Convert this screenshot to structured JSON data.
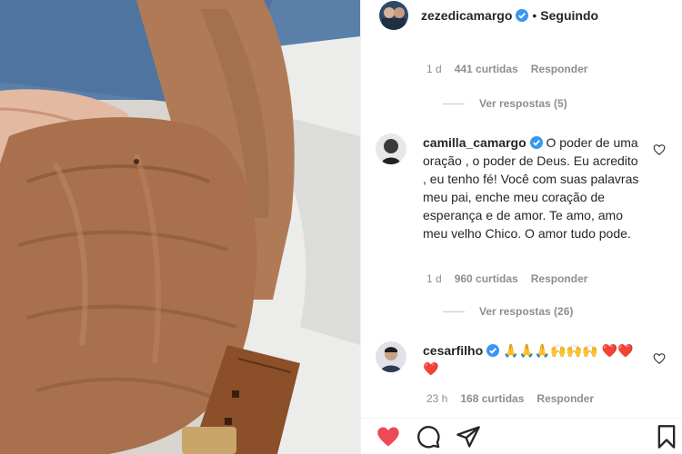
{
  "post": {
    "username": "zezedicamargo",
    "separator": "•",
    "follow_label": "Seguindo"
  },
  "comments": [
    {
      "time": "1 d",
      "likes": "441 curtidas",
      "reply": "Responder",
      "view_replies": "Ver respostas (5)"
    },
    {
      "username": "camilla_camargo",
      "text": "O poder de uma oração , o poder de Deus. Eu acredito , eu tenho fé! Você com suas palavras meu pai, enche meu coração de esperança e de amor. Te amo, amo meu velho Chico. O amor tudo pode.",
      "time": "1 d",
      "likes": "960 curtidas",
      "reply": "Responder",
      "view_replies": "Ver respostas (26)"
    },
    {
      "username": "cesarfilho",
      "text": "🙏🙏🙏🙌🙌🙌 ❤️❤️❤️",
      "time": "23 h",
      "likes": "168 curtidas",
      "reply": "Responder"
    }
  ],
  "colors": {
    "text": "#262626",
    "muted": "#8e8e8e",
    "verified": "#3897f0",
    "like_red": "#ed4956"
  },
  "icons": {
    "like": "heart-filled-icon",
    "comment": "comment-icon",
    "share": "paper-plane-icon",
    "save": "bookmark-icon",
    "comment_like": "heart-outline-icon"
  }
}
